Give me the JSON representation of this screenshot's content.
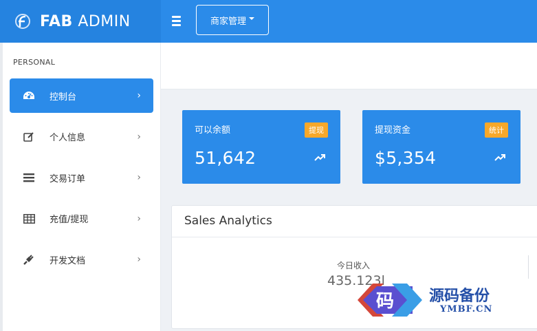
{
  "app": {
    "brand_bold": "FAB",
    "brand_light": "ADMIN",
    "accent_color": "#2b8be9",
    "brand_color": "#2583e0",
    "badge_color": "#f7a82a"
  },
  "header": {
    "menu_toggle_icon": "hamburger-icon",
    "dropdown_label": "商家管理"
  },
  "sidebar": {
    "section_label": "PERSONAL",
    "items": [
      {
        "label": "控制台",
        "icon": "dashboard-gauge-icon",
        "active": true
      },
      {
        "label": "个人信息",
        "icon": "edit-icon",
        "active": false
      },
      {
        "label": "交易订单",
        "icon": "list-icon",
        "active": false
      },
      {
        "label": "充值/提现",
        "icon": "table-icon",
        "active": false
      },
      {
        "label": "开发文档",
        "icon": "plug-icon",
        "active": false
      }
    ]
  },
  "stats": [
    {
      "label": "可以余额",
      "badge": "提现",
      "value": "51,642",
      "icon": "trend-up-icon"
    },
    {
      "label": "提现资金",
      "badge": "统计",
      "value": "$5,354",
      "icon": "trend-up-icon"
    }
  ],
  "analytics": {
    "title": "Sales Analytics",
    "today_label": "今日收入",
    "today_value": "435.123l"
  },
  "watermark": {
    "logo_char": "码",
    "title": "源码备份",
    "subtitle": "YMBF.CN"
  }
}
